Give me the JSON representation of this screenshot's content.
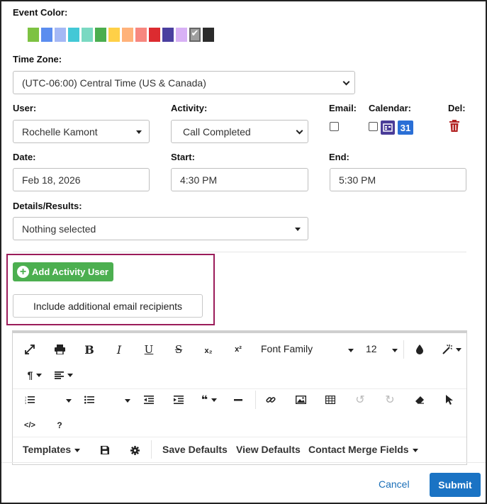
{
  "event_color": {
    "label": "Event Color:",
    "swatches": [
      "#7dc242",
      "#5b8def",
      "#a4b8f5",
      "#43c8d6",
      "#7ad9c2",
      "#4bae4f",
      "#ffd047",
      "#ffb27a",
      "#f7877f",
      "#dc2b30",
      "#4a3f9f",
      "#d8b1f5",
      "#9e9e9e",
      "#2b2b2b"
    ],
    "selected_index": 12
  },
  "time_zone": {
    "label": "Time Zone:",
    "value": "(UTC-06:00) Central Time (US & Canada)"
  },
  "user": {
    "label": "User:",
    "value": "Rochelle Kamont"
  },
  "activity": {
    "label": "Activity:",
    "value": "Call Completed"
  },
  "email": {
    "label": "Email:"
  },
  "calendar": {
    "label": "Calendar:",
    "gcal_day": "31"
  },
  "del": {
    "label": "Del:"
  },
  "date": {
    "label": "Date:",
    "value": "Feb 18, 2026"
  },
  "start": {
    "label": "Start:",
    "value": "4:30 PM"
  },
  "end": {
    "label": "End:",
    "value": "5:30 PM"
  },
  "details": {
    "label": "Details/Results:",
    "value": "Nothing selected"
  },
  "buttons": {
    "add_activity_user": "Add Activity User",
    "include_email": "Include additional email recipients"
  },
  "editor": {
    "font_family": "Font Family",
    "font_size": "12",
    "templates": "Templates",
    "save_defaults": "Save Defaults",
    "view_defaults": "View Defaults",
    "contact_merge_fields": "Contact Merge Fields",
    "help": "?"
  },
  "footer": {
    "cancel": "Cancel",
    "submit": "Submit"
  },
  "colors": {
    "accent": "#1a73c4",
    "green": "#4caf50",
    "highlight": "#9b1c5a",
    "delete": "#b22222"
  }
}
